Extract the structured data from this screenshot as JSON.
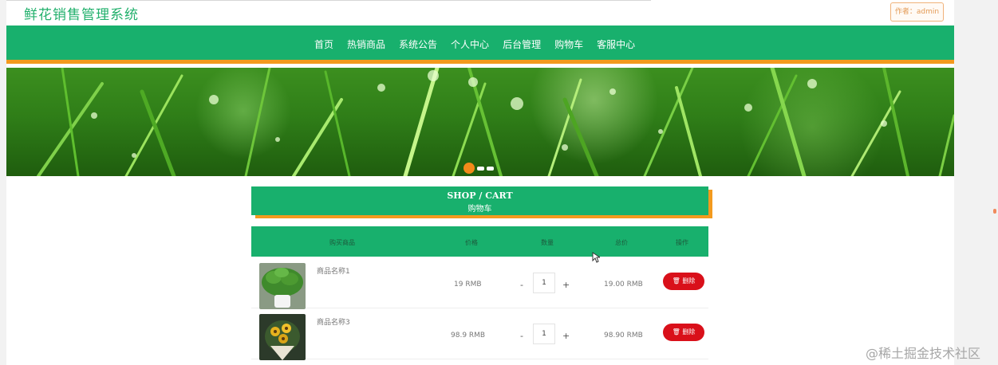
{
  "site": {
    "title": "鲜花销售管理系统",
    "user_badge": "作者：admin"
  },
  "nav": {
    "items": [
      "首页",
      "热销商品",
      "系统公告",
      "个人中心",
      "后台管理",
      "购物车",
      "客服中心"
    ]
  },
  "banner": {
    "slide_count": 3,
    "active_slide": 1
  },
  "cart": {
    "heading_en": "SHOP / CART",
    "heading_zh": "购物车",
    "columns": [
      "购买商品",
      "价格",
      "数量",
      "总价",
      "操作"
    ],
    "rows": [
      {
        "name": "商品名称1",
        "price": "19 RMB",
        "minus": "-",
        "qty": "1",
        "plus": "+",
        "subtotal": "19.00 RMB",
        "delete": "删除"
      },
      {
        "name": "商品名称3",
        "price": "98.9 RMB",
        "minus": "-",
        "qty": "1",
        "plus": "+",
        "subtotal": "98.90 RMB",
        "delete": "删除"
      }
    ]
  },
  "watermark": "@稀土掘金技术社区",
  "colors": {
    "primary_green": "#18b06d",
    "accent_orange": "#f39a1e",
    "delete_red": "#d9101a"
  }
}
